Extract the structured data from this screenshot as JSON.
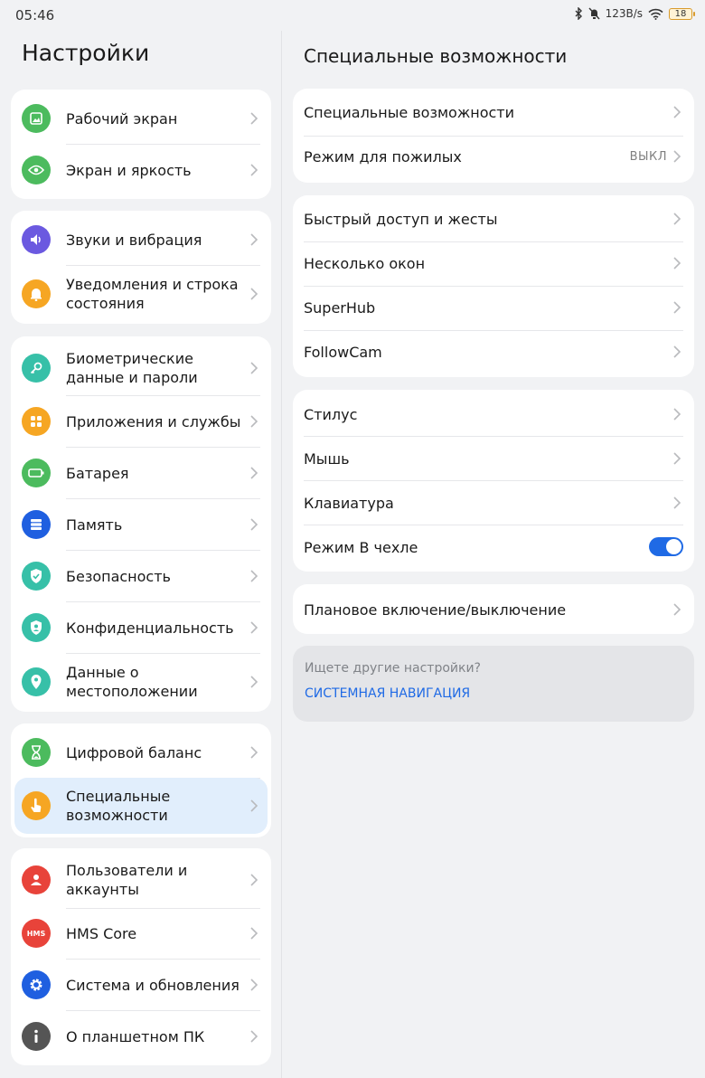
{
  "status": {
    "time": "05:46",
    "net_speed": "123B/s",
    "battery": "18"
  },
  "left_panel": {
    "title": "Настройки",
    "groups": [
      {
        "items": [
          {
            "label": "Рабочий экран",
            "icon": "home-screen-icon",
            "color": "#4cbb5e"
          },
          {
            "label": "Экран и яркость",
            "icon": "eye-icon",
            "color": "#4cbb5e"
          }
        ]
      },
      {
        "items": [
          {
            "label": "Звуки и вибрация",
            "icon": "speaker-icon",
            "color": "#6b59e0"
          },
          {
            "label": "Уведомления и строка состояния",
            "icon": "bell-icon",
            "color": "#f6a623"
          }
        ]
      },
      {
        "items": [
          {
            "label": "Биометрические данные и пароли",
            "icon": "key-icon",
            "color": "#37c0a8"
          },
          {
            "label": "Приложения и службы",
            "icon": "apps-grid-icon",
            "color": "#f6a623"
          },
          {
            "label": "Батарея",
            "icon": "battery-icon",
            "color": "#4cbb5e"
          },
          {
            "label": "Память",
            "icon": "storage-icon",
            "color": "#1f5fe0"
          },
          {
            "label": "Безопасность",
            "icon": "shield-check-icon",
            "color": "#37c0a8"
          },
          {
            "label": "Конфиденциальность",
            "icon": "privacy-shield-icon",
            "color": "#37c0a8"
          },
          {
            "label": "Данные о местоположении",
            "icon": "location-pin-icon",
            "color": "#37c0a8"
          }
        ]
      },
      {
        "items": [
          {
            "label": "Цифровой баланс",
            "icon": "hourglass-icon",
            "color": "#4cbb5e"
          },
          {
            "label": "Специальные возможности",
            "icon": "hand-icon",
            "color": "#f6a623"
          }
        ]
      },
      {
        "items": [
          {
            "label": "Пользователи и аккаунты",
            "icon": "user-icon",
            "color": "#e8433a"
          },
          {
            "label": "HMS Core",
            "icon": "hms-core-icon",
            "color": "#e8433a",
            "icon_text": "HMS"
          },
          {
            "label": "Система и обновления",
            "icon": "gear-icon",
            "color": "#1f5fe0"
          },
          {
            "label": "О планшетном ПК",
            "icon": "info-icon",
            "color": "#555555"
          }
        ]
      }
    ]
  },
  "right_panel": {
    "title": "Специальные возможности",
    "groups": [
      {
        "items": [
          {
            "label": "Специальные возможности"
          },
          {
            "label": "Режим для пожилых",
            "value": "ВЫКЛ"
          }
        ]
      },
      {
        "items": [
          {
            "label": "Быстрый доступ и жесты"
          },
          {
            "label": "Несколько окон"
          },
          {
            "label": "SuperHub"
          },
          {
            "label": "FollowCam"
          }
        ]
      },
      {
        "items": [
          {
            "label": "Стилус"
          },
          {
            "label": "Мышь"
          },
          {
            "label": "Клавиатура"
          },
          {
            "label": "Режим В чехле",
            "toggle": true
          }
        ]
      },
      {
        "items": [
          {
            "label": "Плановое включение/выключение"
          }
        ]
      }
    ],
    "search": {
      "question": "Ищете другие настройки?",
      "link": "СИСТЕМНАЯ НАВИГАЦИЯ"
    }
  },
  "accent_color": "#1f6ae5"
}
